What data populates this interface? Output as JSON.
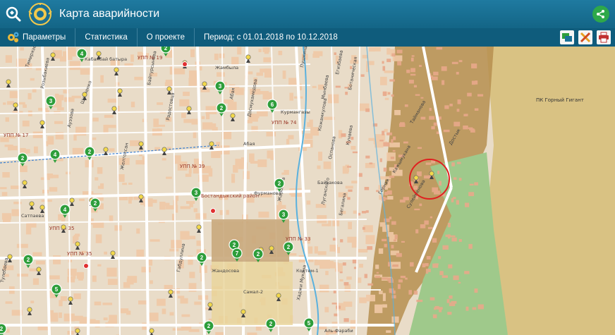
{
  "header": {
    "title": "Карта аварийности",
    "logo_icon": "magnifier-logo-icon",
    "emblem_icon": "kazakhstan-emblem-icon",
    "share_icon": "share-icon",
    "accent": "#1b7398"
  },
  "toolbar": {
    "params_label": "Параметры",
    "stats_label": "Статистика",
    "about_label": "О проекте",
    "period_label": "Период: с 01.01.2018 по 10.12.2018",
    "right_icons": [
      "map-layers-icon",
      "tools-icon",
      "print-icon"
    ]
  },
  "map": {
    "park_label": "ПК Горный Гигант",
    "district_labels": [
      "УПП № 19",
      "УПП № 17",
      "УПП № 74",
      "УПП № 39",
      "УПП № 35",
      "УПП № 33",
      "УПП № 35",
      "Бостандыкский район"
    ],
    "street_labels": [
      "Кабанбай батыра",
      "Жамбыла",
      "Шевченко",
      "Абая",
      "Сатпаева",
      "Жандосова",
      "Тимирязева",
      "Габдуллина",
      "Тулебаева",
      "Желтоксан",
      "Байтурсынова",
      "Ауэзова",
      "Радостовца",
      "Розыбакиева",
      "Досмухамедова",
      "Пушкина",
      "Кунаева",
      "Оспанова",
      "Луганского",
      "Кожамкулова",
      "Байзакова",
      "Курмангазы",
      "Ботаническая",
      "Егизбаева",
      "Мынбаева",
      "Абая",
      "Фурманова",
      "Бегалина",
      "Самал-2",
      "Жарокова",
      "Коктем-1",
      "Хаджи Мукана",
      "Тайманова",
      "Достык",
      "Кажымукана",
      "Горная",
      "Сулейменова",
      "Аль-Фараби"
    ],
    "cluster_counts": [
      4,
      2,
      3,
      3,
      2,
      6,
      2,
      4,
      2,
      3,
      2,
      4,
      2,
      3,
      2,
      2,
      7,
      2,
      2,
      2,
      5,
      2,
      5,
      2,
      2
    ],
    "colors": {
      "city": "#f0c9a6",
      "grid_block": "#ecd9c6",
      "highlight_zone": "#b68f50",
      "park": "#9fc98b",
      "mountain": "#d9c283",
      "cluster": "#2e9e3b",
      "highlight_circle": "#e02020"
    }
  }
}
